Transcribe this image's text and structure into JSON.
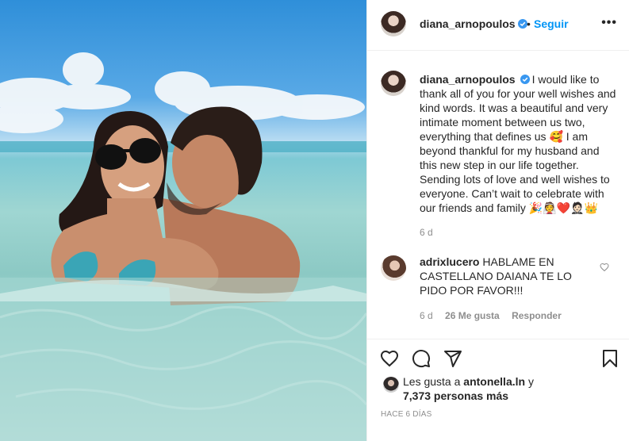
{
  "post": {
    "username": "diana_arnopoulos",
    "follow_label": "Seguir",
    "separator": "•",
    "more_label": "•••",
    "colors": {
      "accent": "#0095f6",
      "verified": "#3897f0",
      "muted": "#8e8e8e",
      "text": "#262626",
      "heart": "#ed4956"
    }
  },
  "caption": {
    "username": "diana_arnopoulos",
    "text_1": "I would like to thank all of you for your well wishes and kind words. It was a beautiful and very intimate moment between us two, everything that defines us ",
    "emoji_1": "🥰",
    "text_2": " I am beyond thankful for my husband and this new step in our life together. Sending lots of love and well wishes to everyone. Can’t wait to celebrate with our friends and family ",
    "emoji_2": "🎉👰❤️🤵🏻👑",
    "time": "6 d"
  },
  "comment": {
    "username": "adrixlucero",
    "text": "HABLAME EN CASTELLANO DAIANA TE LO PIDO POR FAVOR!!!",
    "time": "6 d",
    "likes": "26 Me gusta",
    "reply_label": "Responder"
  },
  "likes": {
    "prefix": "Les gusta a ",
    "user": "antonella.ln",
    "joiner": " y",
    "count": "7,373 personas más"
  },
  "post_time": "HACE 6 DÍAS",
  "icons": [
    "heart-icon",
    "comment-icon",
    "share-icon",
    "bookmark-icon",
    "verified-badge-icon",
    "more-options-icon"
  ]
}
